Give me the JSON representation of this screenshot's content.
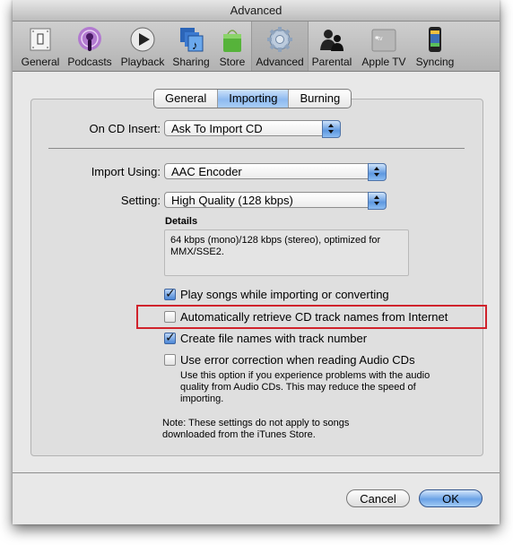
{
  "window": {
    "title": "Advanced"
  },
  "toolbar": {
    "items": [
      {
        "label": "General",
        "icon": "switch-icon",
        "selected": false
      },
      {
        "label": "Podcasts",
        "icon": "podcast-icon",
        "selected": false
      },
      {
        "label": "Playback",
        "icon": "play-icon",
        "selected": false
      },
      {
        "label": "Sharing",
        "icon": "sharing-music-icon",
        "selected": false
      },
      {
        "label": "Store",
        "icon": "shopping-bag-icon",
        "selected": false
      },
      {
        "label": "Advanced",
        "icon": "gear-icon",
        "selected": true
      },
      {
        "label": "Parental",
        "icon": "parental-people-icon",
        "selected": false
      },
      {
        "label": "Apple TV",
        "icon": "apple-tv-icon",
        "selected": false
      },
      {
        "label": "Syncing",
        "icon": "iphone-icon",
        "selected": false
      }
    ]
  },
  "tabs": [
    {
      "label": "General",
      "active": false
    },
    {
      "label": "Importing",
      "active": true
    },
    {
      "label": "Burning",
      "active": false
    }
  ],
  "form": {
    "on_cd_insert": {
      "label": "On CD Insert:",
      "value": "Ask To Import CD"
    },
    "import_using": {
      "label": "Import Using:",
      "value": "AAC Encoder"
    },
    "setting": {
      "label": "Setting:",
      "value": "High Quality (128 kbps)"
    },
    "details": {
      "title": "Details",
      "text": "64 kbps (mono)/128 kbps (stereo), optimized for MMX/SSE2."
    },
    "checkboxes": [
      {
        "label": "Play songs while importing or converting",
        "checked": true
      },
      {
        "label": "Automatically retrieve CD track names from Internet",
        "checked": false
      },
      {
        "label": "Create file names with track number",
        "checked": true
      },
      {
        "label": "Use error correction when reading Audio CDs",
        "checked": false
      }
    ],
    "error_correction_help": "Use this option if you experience problems with the audio quality from Audio CDs. This may reduce the speed of importing.",
    "note": "Note: These settings do not apply to songs downloaded from the iTunes Store."
  },
  "buttons": {
    "cancel": "Cancel",
    "ok": "OK"
  },
  "colors": {
    "highlight": "#d0232c",
    "accent": "#6aa2e6"
  }
}
